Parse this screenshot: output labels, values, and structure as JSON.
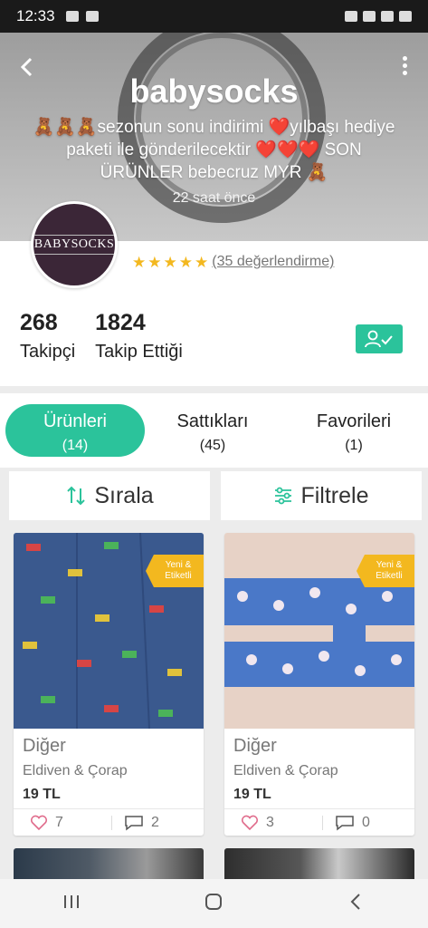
{
  "status_bar": {
    "time": "12:33"
  },
  "header": {
    "shop_name": "babysocks",
    "announcement": "🧸🧸🧸sezonun sonu indirimi ❤️yılbaşı hediye paketi ile gönderilecektir ❤️❤️❤️ SON ÜRÜNLER bebecruz MYR 🧸",
    "posted_ago": "22 saat önce"
  },
  "profile": {
    "avatar_text": "BABYSOCKS",
    "rating_stars": 5,
    "rating_text": "(35 değerlendirme)",
    "followers_count": "268",
    "followers_label": "Takipçi",
    "following_count": "1824",
    "following_label": "Takip Ettiği"
  },
  "tabs": [
    {
      "label": "Ürünleri",
      "count": "(14)",
      "active": true
    },
    {
      "label": "Sattıkları",
      "count": "(45)",
      "active": false
    },
    {
      "label": "Favorileri",
      "count": "(1)",
      "active": false
    }
  ],
  "toolbar": {
    "sort_label": "Sırala",
    "filter_label": "Filtrele"
  },
  "products": [
    {
      "badge": "Yeni & Etiketli",
      "category": "Diğer",
      "subcategory": "Eldiven & Çorap",
      "price": "19 TL",
      "likes": "7",
      "comments": "2"
    },
    {
      "badge": "Yeni & Etiketli",
      "category": "Diğer",
      "subcategory": "Eldiven & Çorap",
      "price": "19 TL",
      "likes": "3",
      "comments": "0"
    }
  ],
  "colors": {
    "accent": "#2bc39b",
    "badge": "#f3b81f"
  }
}
